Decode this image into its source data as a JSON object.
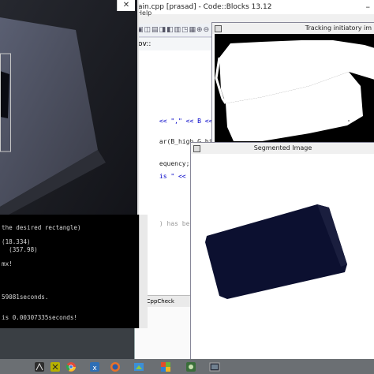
{
  "codeblocks": {
    "title": "ain.cpp [prasad] - Code::Blocks 13.12",
    "menu": "Help",
    "editor_tab": "ov::",
    "minimize_glyph": "–",
    "code_lines": [
      {
        "pre": "<< \",\" << B << \")\" <<",
        "kind": "mix"
      },
      {
        "pre": "ar(B_high,G_high,R_hi",
        "kind": "plain"
      },
      {
        "pre": "equency;",
        "kind": "plain"
      },
      {
        "pre": "is \" << time",
        "kind": "mix"
      },
      {
        "pre": ") has begun",
        "kind": "comment"
      }
    ],
    "log_tab": "CppCheck"
  },
  "tracking": {
    "title": "Tracking initiatory im"
  },
  "segmented": {
    "title": "Segmented Image"
  },
  "camera": {
    "close_glyph": "✕"
  },
  "console": {
    "lines": [
      "the desired rectangle)",
      "(18.334)",
      "  (357.98)",
      "mx!",
      "59081seconds.",
      "is 0.00307335seconds!"
    ]
  },
  "taskbar": {
    "items": [
      "app-icon-1",
      "app-icon-2",
      "chrome-icon",
      "app-icon-4",
      "firefox-icon",
      "app-icon-6",
      "app-icon-7",
      "app-icon-8",
      "app-icon-9"
    ]
  },
  "colors": {
    "camera_bg": "#1c1d22",
    "segment_object": "#0c1030",
    "tracking_white": "#ffffff"
  }
}
